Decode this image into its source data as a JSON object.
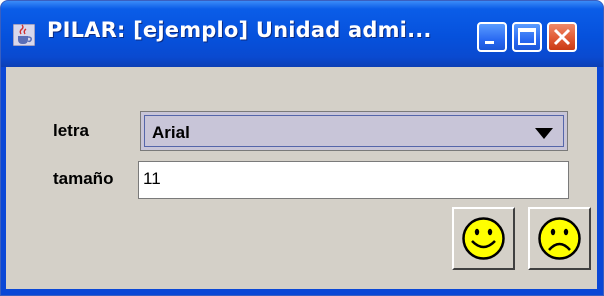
{
  "window": {
    "title": "PILAR: [ejemplo] Unidad admi...",
    "app_icon": "java-cup-icon",
    "controls": [
      "minimize-icon",
      "maximize-icon",
      "close-icon"
    ]
  },
  "form": {
    "font_label": "letra",
    "font_value": "Arial",
    "size_label": "tamaño",
    "size_value": "11"
  },
  "buttons": {
    "ok_icon": "happy-face-icon",
    "cancel_icon": "sad-face-icon"
  },
  "colors": {
    "titlebar": "#0651dc",
    "panel": "#d4d0c8",
    "face_fill": "#ffff00",
    "close_button": "#e05a34"
  }
}
